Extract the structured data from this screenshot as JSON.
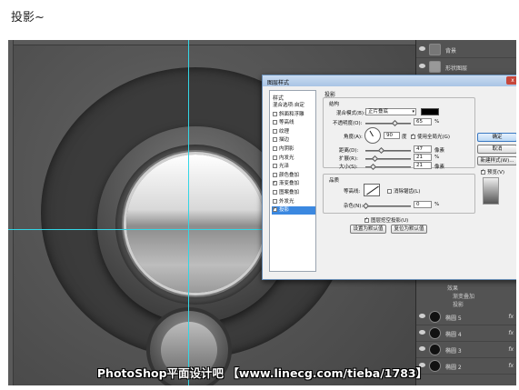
{
  "heading": "投影~",
  "watermark": "PhotoShop平面设计吧 【www.linecg.com/tieba/1783】",
  "dialog": {
    "title": "图层样式",
    "styles_header": "样式",
    "styles": [
      {
        "label": "混合选项:自定",
        "checkbox": false,
        "checked": false,
        "selected": false
      },
      {
        "label": "斜面和浮雕",
        "checkbox": true,
        "checked": false,
        "selected": false
      },
      {
        "label": "等高线",
        "checkbox": true,
        "checked": false,
        "selected": false
      },
      {
        "label": "纹理",
        "checkbox": true,
        "checked": false,
        "selected": false
      },
      {
        "label": "描边",
        "checkbox": true,
        "checked": false,
        "selected": false
      },
      {
        "label": "内阴影",
        "checkbox": true,
        "checked": false,
        "selected": false
      },
      {
        "label": "内发光",
        "checkbox": true,
        "checked": false,
        "selected": false
      },
      {
        "label": "光泽",
        "checkbox": true,
        "checked": false,
        "selected": false
      },
      {
        "label": "颜色叠加",
        "checkbox": true,
        "checked": false,
        "selected": false
      },
      {
        "label": "渐变叠加",
        "checkbox": true,
        "checked": true,
        "selected": false
      },
      {
        "label": "图案叠加",
        "checkbox": true,
        "checked": false,
        "selected": false
      },
      {
        "label": "外发光",
        "checkbox": true,
        "checked": false,
        "selected": false
      },
      {
        "label": "投影",
        "checkbox": true,
        "checked": true,
        "selected": true
      }
    ],
    "panel_title": "投影",
    "structure_title": "结构",
    "blend_mode_label": "混合模式(B):",
    "blend_mode_value": "正片叠底",
    "opacity_label": "不透明度(O):",
    "opacity_value": "65",
    "opacity_fraction": 0.65,
    "angle_label": "角度(A):",
    "angle_value": "90",
    "angle_unit": "度",
    "global_light_label": "使用全局光(G)",
    "distance_label": "距离(D):",
    "distance_value": "47",
    "size_unit": "像素",
    "spread_label": "扩展(R):",
    "spread_value": "21",
    "size_label": "大小(S):",
    "size_value": "21",
    "quality_title": "品质",
    "contour_label": "等高线:",
    "antialias_label": "消除锯齿(L)",
    "noise_label": "杂色(N):",
    "noise_value": "0",
    "knockout_label": "图层挖空投影(U)",
    "set_default_label": "设置为默认值",
    "reset_default_label": "复位为默认值",
    "ok_label": "确定",
    "cancel_label": "取消",
    "new_style_label": "新建样式(W)...",
    "preview_label": "预览(V)",
    "percent": "%",
    "close_glyph": "x"
  },
  "layers": {
    "top_items": [
      "背景",
      "形状图层"
    ],
    "effects_label": "效果",
    "effect_items": [
      "渐变叠加",
      "投影"
    ],
    "items": [
      {
        "name": "椭圆 5",
        "fx": "fx"
      },
      {
        "name": "椭圆 4",
        "fx": "fx"
      },
      {
        "name": "椭圆 3",
        "fx": "fx"
      },
      {
        "name": "椭圆 2",
        "fx": "fx"
      }
    ]
  },
  "colors": {
    "guide": "#33d6e6",
    "shadow_color": "#000000",
    "selection": "#3b88e0"
  }
}
